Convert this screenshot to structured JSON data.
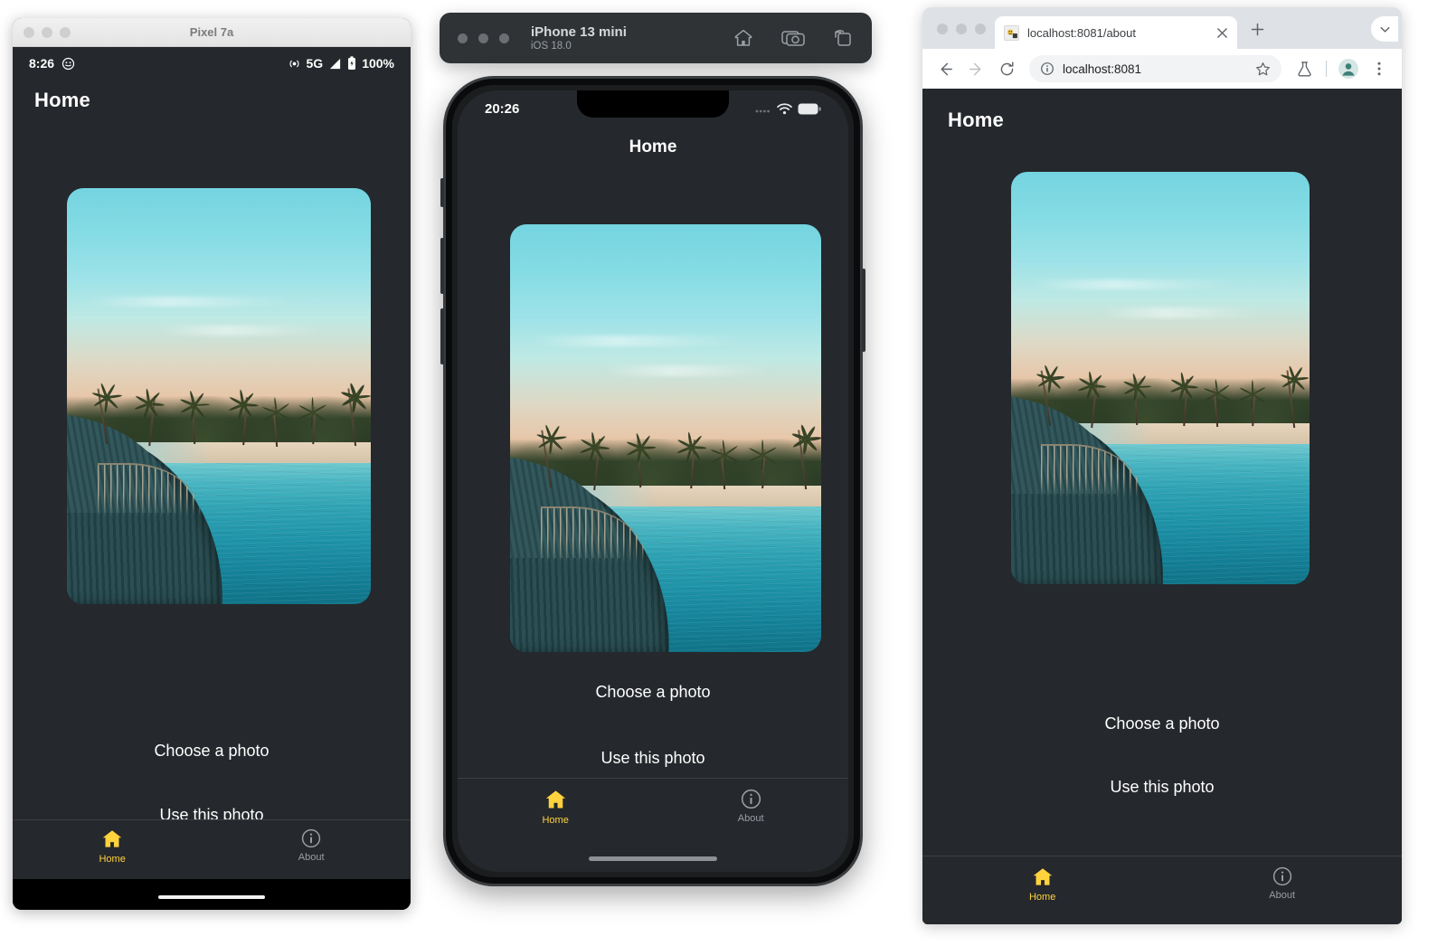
{
  "android": {
    "window_title": "Pixel 7a",
    "status": {
      "time": "8:26",
      "network": "5G",
      "battery": "100%"
    },
    "app": {
      "header_title": "Home",
      "choose_label": "Choose a photo",
      "use_label": "Use this photo",
      "tabs": [
        {
          "label": "Home",
          "icon": "home-icon",
          "active": true
        },
        {
          "label": "About",
          "icon": "info-icon",
          "active": false
        }
      ]
    }
  },
  "iphone": {
    "device_name": "iPhone 13 mini",
    "os_version": "iOS 18.0",
    "toolbar_icons": [
      "home-icon",
      "screenshot-camera-icon",
      "rotate-device-icon"
    ],
    "status": {
      "time": "20:26"
    },
    "app": {
      "header_title": "Home",
      "choose_label": "Choose a photo",
      "use_label": "Use this photo",
      "tabs": [
        {
          "label": "Home",
          "icon": "home-icon",
          "active": true
        },
        {
          "label": "About",
          "icon": "info-icon",
          "active": false
        }
      ]
    }
  },
  "browser": {
    "tab_title": "localhost:8081/about",
    "omnibox_value": "localhost:8081",
    "app": {
      "header_title": "Home",
      "choose_label": "Choose a photo",
      "use_label": "Use this photo",
      "tabs": [
        {
          "label": "Home",
          "icon": "home-icon",
          "active": true
        },
        {
          "label": "About",
          "icon": "info-icon",
          "active": false
        }
      ]
    }
  },
  "colors": {
    "app_background": "#25282c",
    "accent_yellow": "#ffd33d",
    "inactive_gray": "#9a9ea3",
    "browser_chrome": "#dee1e6"
  },
  "photo": {
    "alt": "tropical island boardwalk over turquoise lagoon at sunset"
  }
}
